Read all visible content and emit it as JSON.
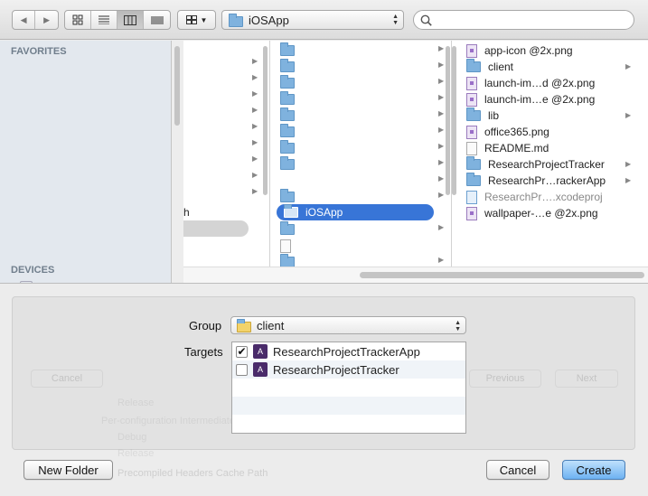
{
  "toolbar": {
    "path_label": "iOSApp",
    "search_placeholder": ""
  },
  "sidebar": {
    "favorites_header": "FAVORITES",
    "devices_header": "DEVICES",
    "partial_item": "h"
  },
  "columns": {
    "col3_selected": "iOSApp",
    "files": [
      {
        "label": "app-icon @2x.png",
        "icon": "image-file-icon",
        "has_arrow": false,
        "dim": false
      },
      {
        "label": "client",
        "icon": "folder-icon",
        "has_arrow": true,
        "dim": false
      },
      {
        "label": "launch-im…d @2x.png",
        "icon": "image-file-icon",
        "has_arrow": false,
        "dim": false
      },
      {
        "label": "launch-im…e @2x.png",
        "icon": "image-file-icon",
        "has_arrow": false,
        "dim": false
      },
      {
        "label": "lib",
        "icon": "folder-icon",
        "has_arrow": true,
        "dim": false
      },
      {
        "label": "office365.png",
        "icon": "image-file-icon",
        "has_arrow": false,
        "dim": false
      },
      {
        "label": "README.md",
        "icon": "text-file-icon",
        "has_arrow": false,
        "dim": false
      },
      {
        "label": "ResearchProjectTracker",
        "icon": "folder-icon",
        "has_arrow": true,
        "dim": false
      },
      {
        "label": "ResearchPr…rackerApp",
        "icon": "folder-icon",
        "has_arrow": true,
        "dim": false
      },
      {
        "label": "ResearchPr….xcodeproj",
        "icon": "xcodeproj-icon",
        "has_arrow": false,
        "dim": true
      },
      {
        "label": "wallpaper-…e @2x.png",
        "icon": "image-file-icon",
        "has_arrow": false,
        "dim": false
      }
    ]
  },
  "options": {
    "group_label": "Group",
    "group_value": "client",
    "targets_label": "Targets",
    "targets": [
      {
        "name": "ResearchProjectTrackerApp",
        "checked": true
      },
      {
        "name": "ResearchProjectTracker",
        "checked": false
      }
    ]
  },
  "background_ghost": {
    "cancel": "Cancel",
    "previous": "Previous",
    "next": "Next",
    "release": "Release",
    "per_config": "Per-configuration Intermediate",
    "debug": "Debug",
    "release2": "Release",
    "precompiled": "Precompiled Headers Cache Path"
  },
  "buttons": {
    "new_folder": "New Folder",
    "cancel": "Cancel",
    "create": "Create"
  },
  "colors": {
    "selection": "#3875d7",
    "primary_button": "#6eb2f2"
  }
}
